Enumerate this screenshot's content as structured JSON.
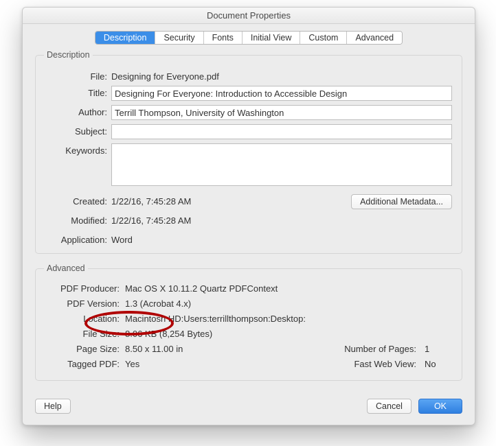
{
  "window": {
    "title": "Document Properties"
  },
  "tabs": {
    "items": [
      {
        "label": "Description",
        "active": true
      },
      {
        "label": "Security"
      },
      {
        "label": "Fonts"
      },
      {
        "label": "Initial View"
      },
      {
        "label": "Custom"
      },
      {
        "label": "Advanced"
      }
    ]
  },
  "description": {
    "legend": "Description",
    "file_label": "File:",
    "file_value": "Designing for Everyone.pdf",
    "title_label": "Title:",
    "title_value": "Designing For Everyone: Introduction to Accessible Design",
    "author_label": "Author:",
    "author_value": "Terrill Thompson, University of Washington",
    "subject_label": "Subject:",
    "subject_value": "",
    "keywords_label": "Keywords:",
    "keywords_value": "",
    "created_label": "Created:",
    "created_value": "1/22/16, 7:45:28 AM",
    "modified_label": "Modified:",
    "modified_value": "1/22/16, 7:45:28 AM",
    "application_label": "Application:",
    "application_value": "Word",
    "additional_metadata": "Additional Metadata..."
  },
  "advanced": {
    "legend": "Advanced",
    "producer_label": "PDF Producer:",
    "producer_value": "Mac OS X 10.11.2 Quartz PDFContext",
    "version_label": "PDF Version:",
    "version_value": "1.3 (Acrobat 4.x)",
    "location_label": "Location:",
    "location_value": "Macintosh HD:Users:terrillthompson:Desktop:",
    "filesize_label": "File Size:",
    "filesize_value": "8.06 KB (8,254 Bytes)",
    "pagesize_label": "Page Size:",
    "pagesize_value": "8.50 x 11.00 in",
    "numpages_label": "Number of Pages:",
    "numpages_value": "1",
    "tagged_label": "Tagged PDF:",
    "tagged_value": "Yes",
    "fastweb_label": "Fast Web View:",
    "fastweb_value": "No"
  },
  "footer": {
    "help": "Help",
    "cancel": "Cancel",
    "ok": "OK"
  }
}
